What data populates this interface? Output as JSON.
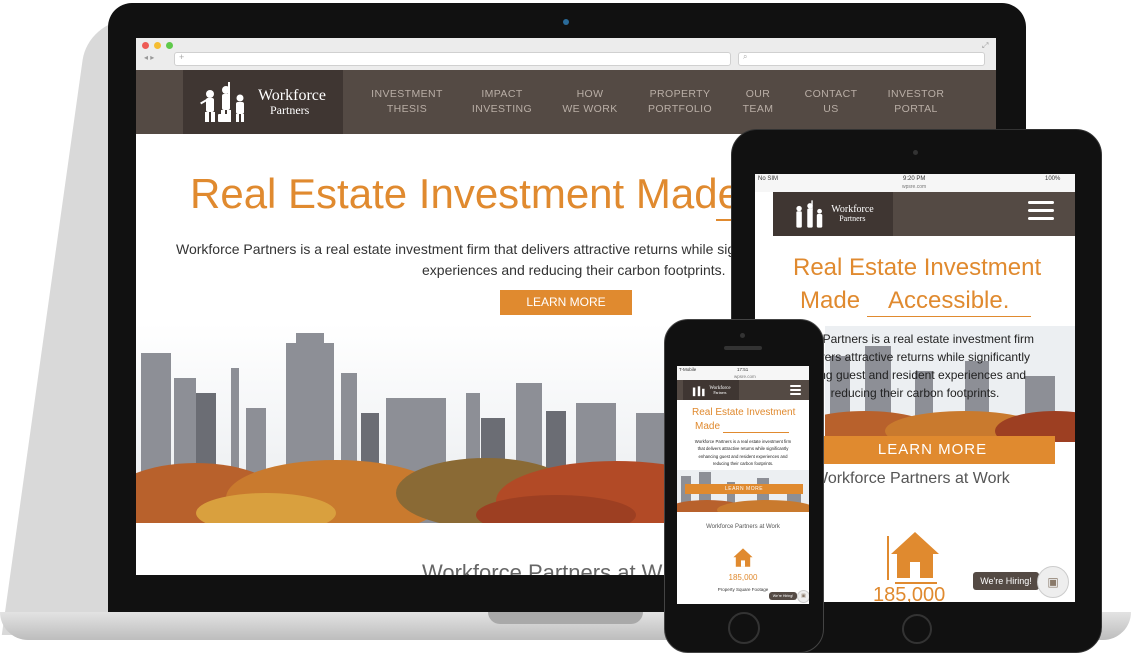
{
  "logo": {
    "line1": "Workforce",
    "line2": "Partners"
  },
  "nav": {
    "items": [
      {
        "l1": "INVESTMENT",
        "l2": "THESIS"
      },
      {
        "l1": "IMPACT",
        "l2": "INVESTING"
      },
      {
        "l1": "HOW",
        "l2": "WE WORK"
      },
      {
        "l1": "PROPERTY",
        "l2": "PORTFOLIO"
      },
      {
        "l1": "OUR",
        "l2": "TEAM"
      },
      {
        "l1": "CONTACT",
        "l2": "US"
      },
      {
        "l1": "INVESTOR",
        "l2": "PORTAL"
      }
    ]
  },
  "laptop": {
    "hero_title": "Real Estate Investment Made",
    "hero_text_line1": "Workforce Partners is a real estate investment firm that delivers attractive returns while signifi",
    "hero_text_line2": "experiences and reducing their carbon footprints.",
    "cta": "LEARN MORE",
    "section_title": "Workforce Partners at W"
  },
  "tablet": {
    "status_left": "No SIM",
    "status_time": "9:20 PM",
    "status_right": "100%",
    "url": "wpsre.com",
    "hero_line1": "Real Estate Investment",
    "hero_made": "Made",
    "hero_word": "Accessible.",
    "text_lines": [
      "orce Partners is a real estate investment firm",
      "delivers attractive returns while significantly",
      "ncing guest and resident experiences and",
      "reducing their carbon footprints."
    ],
    "cta": "LEARN MORE",
    "section_title": "Workforce Partners at Work",
    "stat": "185,000",
    "hiring": "We're Hiring!"
  },
  "phone": {
    "status_left": "T-Mobile",
    "status_time": "17:51",
    "url": "wpsre.com",
    "hero_line1": "Real Estate Investment",
    "hero_made": "Made",
    "text_lines": [
      "Workforce Partners is a real estate investment firm",
      "that delivers attractive returns while significantly",
      "enhancing guest and resident experiences and",
      "reducing their carbon footprints."
    ],
    "cta": "LEARN MORE",
    "section_title": "Workforce Partners at Work",
    "stat": "185,000",
    "stat_label": "Property Square Footage",
    "hiring": "We're Hiring!"
  },
  "colors": {
    "accent": "#e08a2f",
    "nav_bg": "#544a44",
    "logo_bg": "#3f3632"
  }
}
